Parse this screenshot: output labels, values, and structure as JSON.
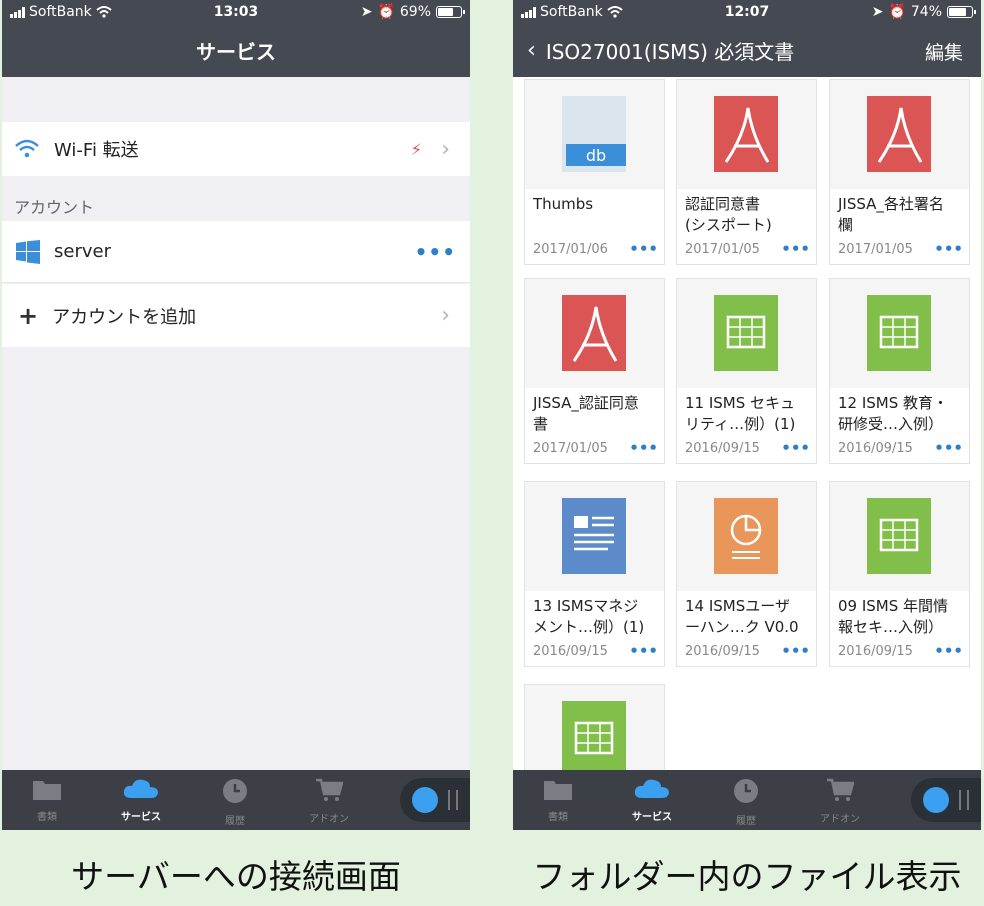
{
  "left_screen": {
    "status": {
      "carrier": "SoftBank",
      "time": "13:03",
      "battery": "69%",
      "battery_level": 0.69
    },
    "title": "サービス",
    "wifi_row": {
      "label": "Wi-Fi 転送"
    },
    "account_section": "アカウント",
    "server_row": {
      "label": "server",
      "dots": "•••"
    },
    "add_row": {
      "label": "アカウントを追加"
    }
  },
  "right_screen": {
    "status": {
      "carrier": "SoftBank",
      "time": "12:07",
      "battery": "74%",
      "battery_level": 0.74
    },
    "back_title": "ISO27001(ISMS) 必須文書",
    "edit": "編集",
    "files": [
      {
        "name": "Thumbs",
        "date": "2017/01/06",
        "type": "db"
      },
      {
        "name": "認証同意書\n(シスポート)",
        "date": "2017/01/05",
        "type": "pdf"
      },
      {
        "name": "JISSA_各社署名\n欄",
        "date": "2017/01/05",
        "type": "pdf"
      },
      {
        "name": "JISSA_認証同意\n書",
        "date": "2017/01/05",
        "type": "pdf"
      },
      {
        "name": "11 ISMS セキュ\nリティ…例）(1)",
        "date": "2016/09/15",
        "type": "sheet"
      },
      {
        "name": "12 ISMS 教育・\n研修受…入例）",
        "date": "2016/09/15",
        "type": "sheet"
      },
      {
        "name": "13 ISMSマネジ\nメント…例）(1)",
        "date": "2016/09/15",
        "type": "doc"
      },
      {
        "name": "14 ISMSユーザ\nーハン…ク V0.0",
        "date": "2016/09/15",
        "type": "slide"
      },
      {
        "name": "09 ISMS 年間情\n報セキ…入例）",
        "date": "2016/09/15",
        "type": "sheet"
      },
      {
        "name": "",
        "date": "",
        "type": "sheet"
      }
    ],
    "db_label": "db",
    "tile_dots": "•••"
  },
  "tabs": [
    {
      "label": "書類",
      "icon": "folder-icon"
    },
    {
      "label": "サービス",
      "icon": "cloud-icon"
    },
    {
      "label": "履歴",
      "icon": "clock-icon"
    },
    {
      "label": "アドオン",
      "icon": "cart-icon"
    }
  ],
  "captions": {
    "left": "サーバーへの接続画面",
    "right": "フォルダー内のファイル表示"
  },
  "colors": {
    "bar": "#454a52",
    "pdf": "#db5555",
    "sheet": "#82bf4a",
    "doc": "#5d8ac8",
    "slide": "#e8965a",
    "db": "#dae5ee",
    "accent": "#2d7fc9"
  }
}
